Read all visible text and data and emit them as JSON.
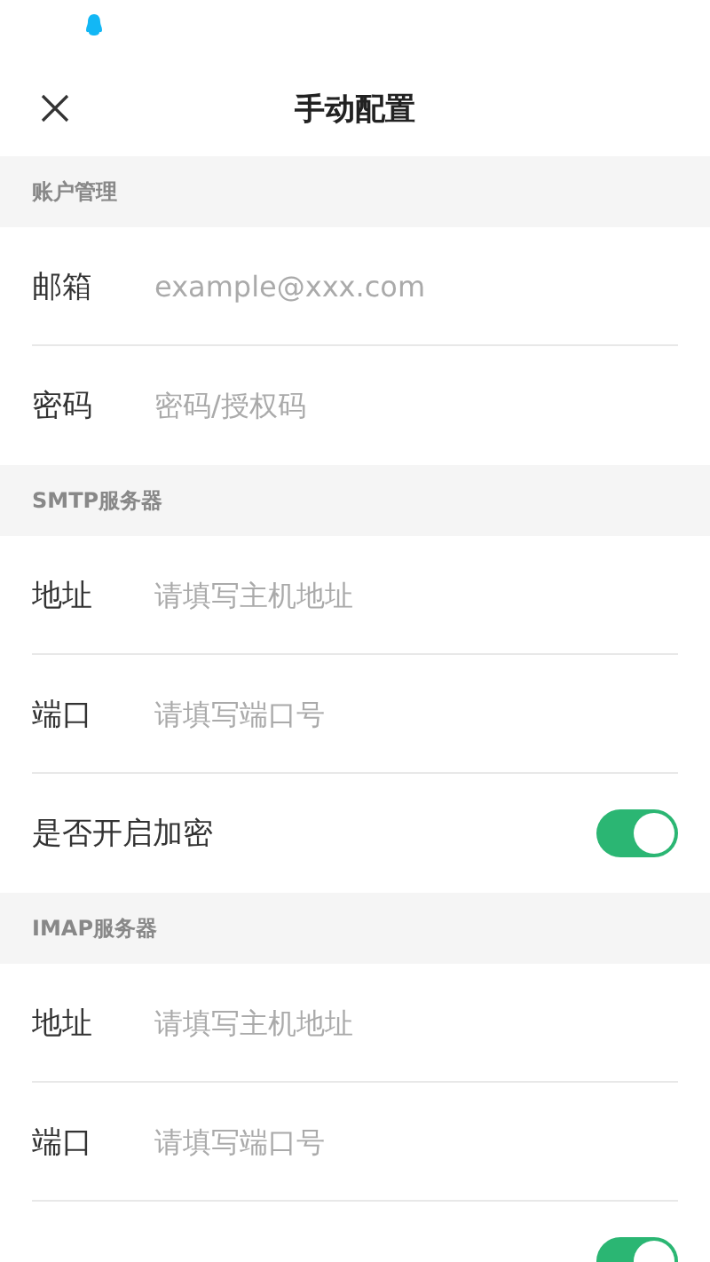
{
  "header": {
    "title": "手动配置"
  },
  "sections": [
    {
      "title": "账户管理",
      "rows": [
        {
          "kind": "field",
          "label": "邮箱",
          "placeholder": "example@xxx.com"
        },
        {
          "kind": "field",
          "label": "密码",
          "placeholder": "密码/授权码"
        }
      ]
    },
    {
      "title": "SMTP服务器",
      "rows": [
        {
          "kind": "field",
          "label": "地址",
          "placeholder": "请填写主机地址"
        },
        {
          "kind": "field",
          "label": "端口",
          "placeholder": "请填写端口号"
        },
        {
          "kind": "toggle",
          "label": "是否开启加密",
          "on": true
        }
      ]
    },
    {
      "title": "IMAP服务器",
      "rows": [
        {
          "kind": "field",
          "label": "地址",
          "placeholder": "请填写主机地址"
        },
        {
          "kind": "field",
          "label": "端口",
          "placeholder": "请填写端口号"
        },
        {
          "kind": "toggle",
          "on": true
        }
      ]
    }
  ]
}
